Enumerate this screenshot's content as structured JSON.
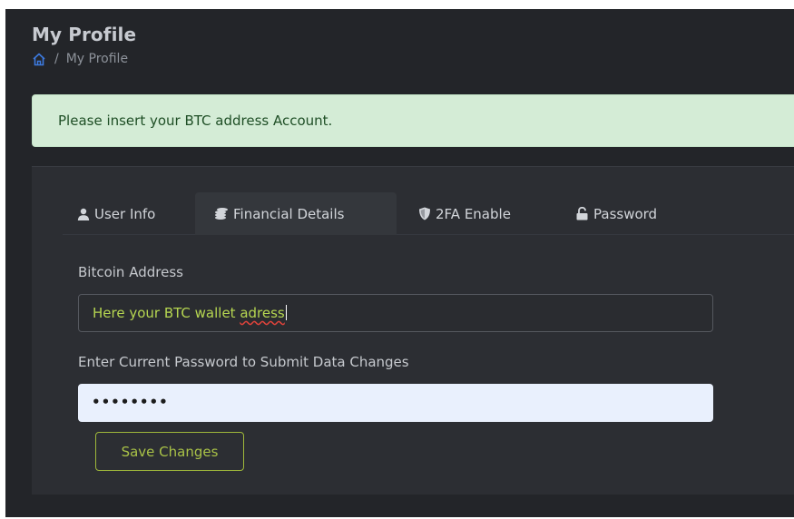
{
  "page": {
    "title": "My Profile",
    "breadcrumb": {
      "separator": "/",
      "current": "My Profile"
    }
  },
  "alert": {
    "message": "Please insert your BTC address Account."
  },
  "tabs": [
    {
      "label": "User Info",
      "icon": "user-icon"
    },
    {
      "label": "Financial Details",
      "icon": "coins-icon",
      "active": true
    },
    {
      "label": "2FA Enable",
      "icon": "shield-icon"
    },
    {
      "label": "Password",
      "icon": "unlock-icon"
    }
  ],
  "form": {
    "bitcoin_label": "Bitcoin Address",
    "bitcoin_value_prefix": "Here your BTC wallet ",
    "bitcoin_value_misspelled": "adress",
    "password_label": "Enter Current Password to Submit Data Changes",
    "password_value": "••••••••",
    "save_label": "Save Changes"
  },
  "colors": {
    "background": "#232529",
    "card": "#2c2e33",
    "alert_bg": "#d4ecd6",
    "alert_text": "#1f4f26",
    "accent": "#b6d651",
    "home_icon": "#3d7be0"
  }
}
